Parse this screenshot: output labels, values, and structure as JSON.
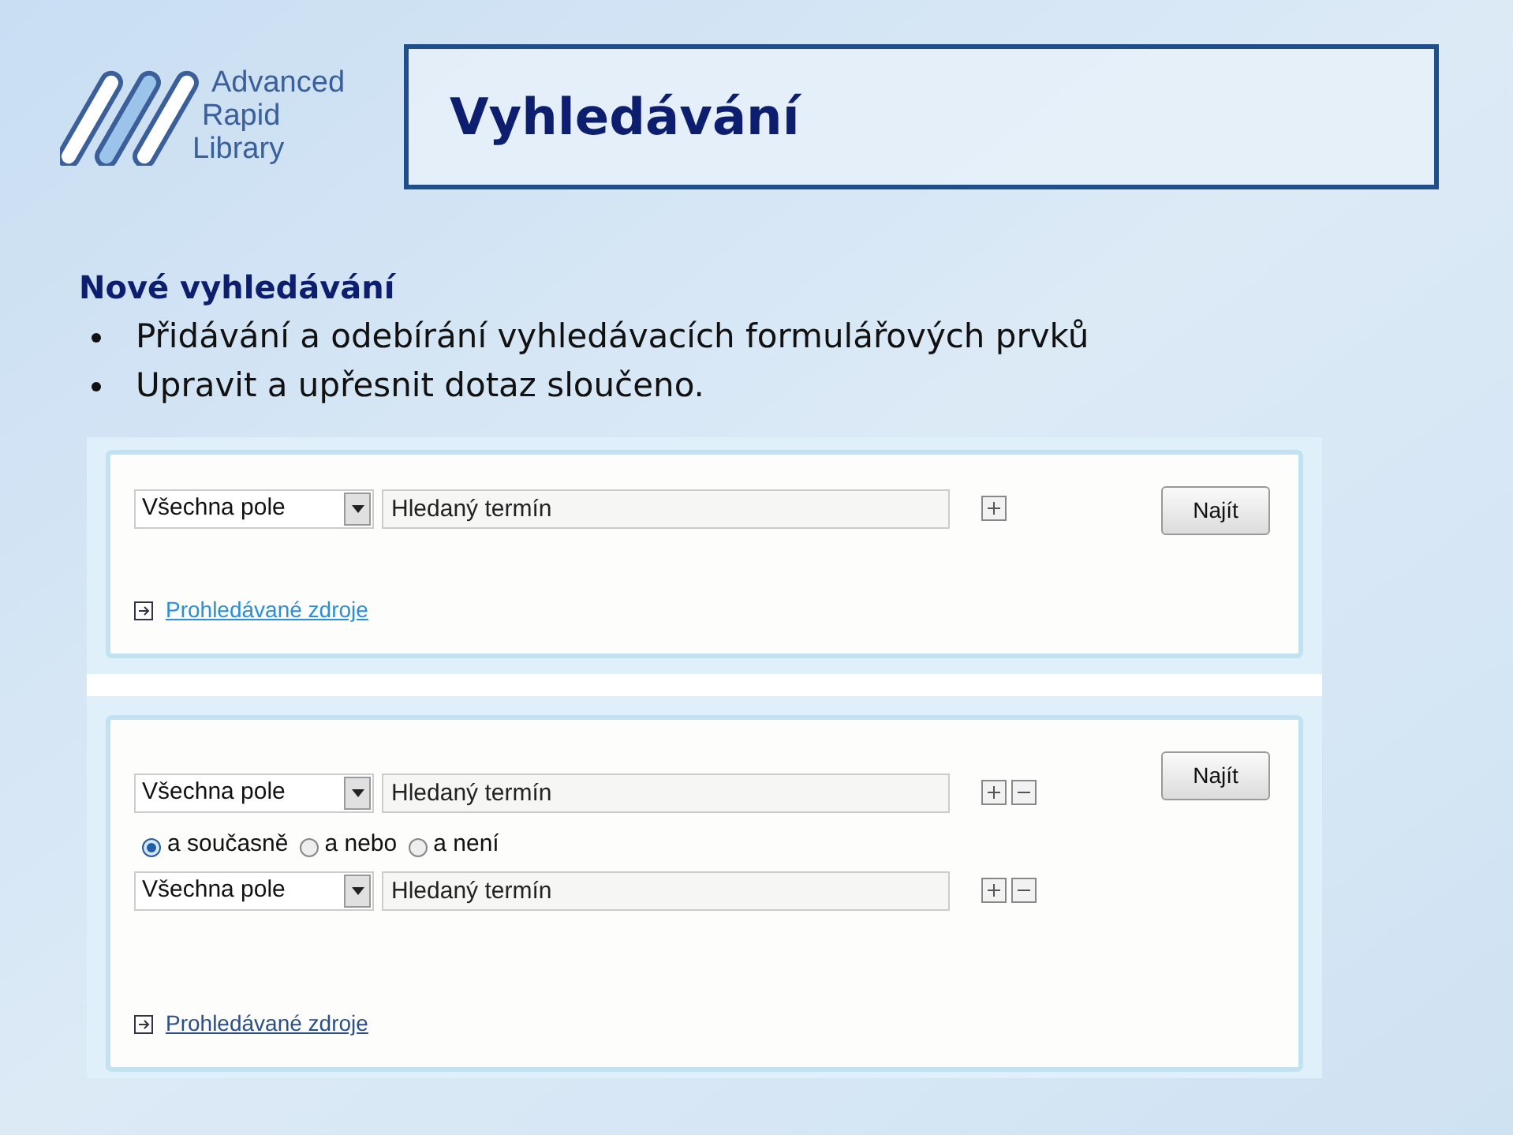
{
  "logo": {
    "lines": [
      "Advanced",
      "Rapid",
      "Library"
    ]
  },
  "title": "Vyhledávání",
  "heading": "Nové vyhledávání",
  "bullets": [
    "Přidávání a odebírání vyhledávacích formulářových prvků",
    "Upravit a upřesnit dotaz sloučeno."
  ],
  "forms": [
    {
      "rows": [
        {
          "kind": "field",
          "select": "Všechna pole",
          "placeholder": "Hledaný termín",
          "removable": false
        }
      ],
      "button": "Najít",
      "link": "Prohledávané zdroje"
    },
    {
      "rows": [
        {
          "kind": "field",
          "select": "Všechna pole",
          "placeholder": "Hledaný termín",
          "removable": true
        },
        {
          "kind": "operators",
          "options": [
            {
              "label": "a současně",
              "selected": true
            },
            {
              "label": "a nebo",
              "selected": false
            },
            {
              "label": "a není",
              "selected": false
            }
          ]
        },
        {
          "kind": "field",
          "select": "Všechna pole",
          "placeholder": "Hledaný termín",
          "removable": true
        }
      ],
      "button": "Najít",
      "link": "Prohledávané zdroje"
    }
  ]
}
